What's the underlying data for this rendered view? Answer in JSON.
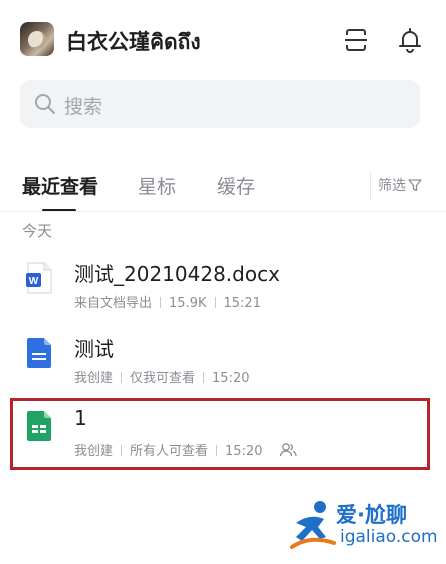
{
  "header": {
    "username": "白衣公瑾คิดถึง",
    "scan_icon": "scan-icon",
    "bell_icon": "bell-icon",
    "avatar_icon": "avatar"
  },
  "search": {
    "placeholder": "搜索"
  },
  "tabs": {
    "items": [
      "最近查看",
      "星标",
      "缓存"
    ],
    "active_index": 0,
    "filter_label": "筛选"
  },
  "section": {
    "label": "今天"
  },
  "files": [
    {
      "name": "测试_20210428.docx",
      "icon": "word-doc-icon",
      "icon_color": "#2b5fd6",
      "meta": [
        "来自文档导出",
        "15.9K",
        "15:21"
      ]
    },
    {
      "name": "测试",
      "icon": "doc-icon",
      "icon_color": "#2f6fdf",
      "meta": [
        "我创建",
        "仅我可查看",
        "15:20"
      ]
    },
    {
      "name": "1",
      "icon": "sheet-icon",
      "icon_color": "#21a366",
      "meta": [
        "我创建",
        "所有人可查看",
        "15:20"
      ],
      "shared_icon": "shared-users-icon"
    }
  ],
  "colors": {
    "highlight": "#b3242b",
    "watermark": "#1e6fc8"
  },
  "watermark": {
    "text": "爱·尬聊",
    "domain": "igaliao.com"
  }
}
